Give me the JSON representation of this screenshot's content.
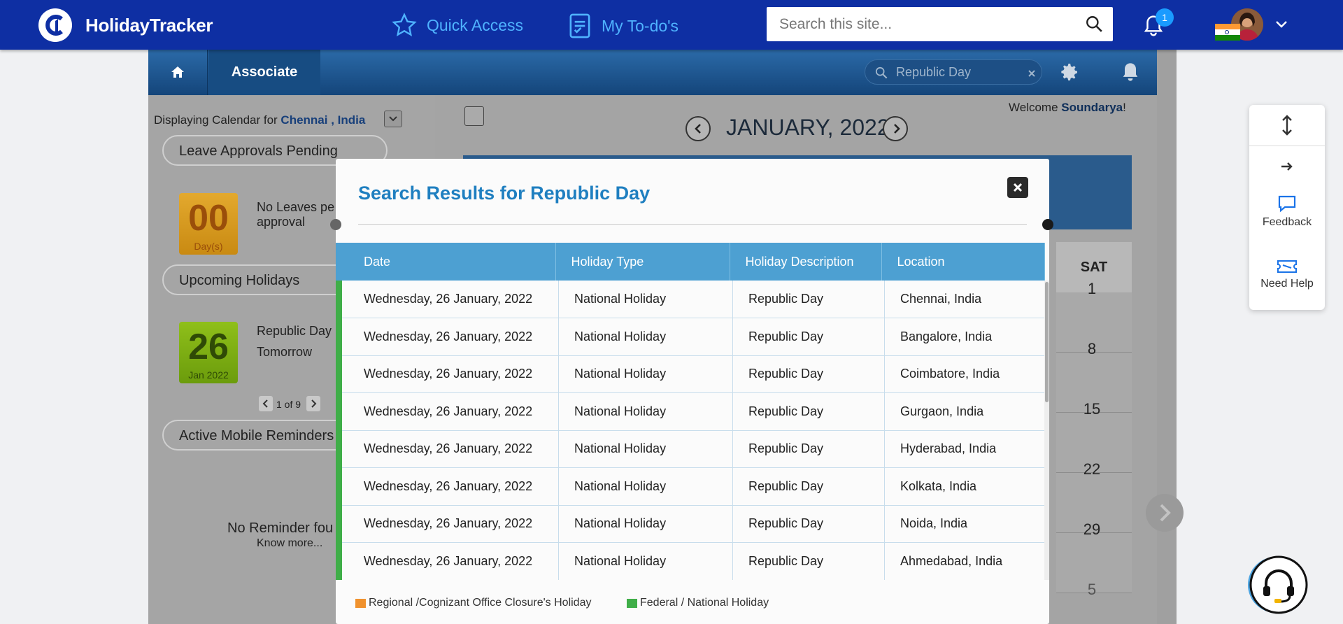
{
  "topbar": {
    "brand": "HolidayTracker",
    "quick_access": "Quick Access",
    "todos": "My To-do's",
    "search_placeholder": "Search this site...",
    "notification_count": "1",
    "accent": "#0e2fa3"
  },
  "subbar": {
    "tab": "Associate",
    "search_value": "Republic Day"
  },
  "left_panel": {
    "display_prefix": "Displaying Calendar for ",
    "location": "Chennai , India",
    "leave_title": "Leave Approvals Pending",
    "leave_count": "00",
    "leave_unit": "Day(s)",
    "leave_text_1": "No Leaves pe",
    "leave_text_2": "approval",
    "upcoming_title": "Upcoming Holidays",
    "upcoming_day": "26",
    "upcoming_month": "Jan 2022",
    "upcoming_name": "Republic Day",
    "upcoming_when": "Tomorrow",
    "pager": "1 of 9",
    "reminders_title": "Active Mobile Reminders",
    "no_reminder": "No Reminder fou",
    "know_more": "Know more..."
  },
  "calendar": {
    "welcome_prefix": "Welcome ",
    "user": "Soundarya",
    "welcome_suffix": "!",
    "month": "JANUARY, 2022",
    "sat_label": "SAT",
    "sat_dates": [
      "1",
      "8",
      "15",
      "22",
      "29",
      "5"
    ]
  },
  "side_panel": {
    "feedback": "Feedback",
    "need_help": "Need Help"
  },
  "modal": {
    "title": "Search Results for Republic Day",
    "columns": [
      "Date",
      "Holiday Type",
      "Holiday Description",
      "Location"
    ],
    "rows": [
      {
        "date": "Wednesday, 26 January, 2022",
        "type": "National Holiday",
        "desc": "Republic Day",
        "location": "Chennai, India"
      },
      {
        "date": "Wednesday, 26 January, 2022",
        "type": "National Holiday",
        "desc": "Republic Day",
        "location": "Bangalore, India"
      },
      {
        "date": "Wednesday, 26 January, 2022",
        "type": "National Holiday",
        "desc": "Republic Day",
        "location": "Coimbatore, India"
      },
      {
        "date": "Wednesday, 26 January, 2022",
        "type": "National Holiday",
        "desc": "Republic Day",
        "location": "Gurgaon, India"
      },
      {
        "date": "Wednesday, 26 January, 2022",
        "type": "National Holiday",
        "desc": "Republic Day",
        "location": "Hyderabad, India"
      },
      {
        "date": "Wednesday, 26 January, 2022",
        "type": "National Holiday",
        "desc": "Republic Day",
        "location": "Kolkata, India"
      },
      {
        "date": "Wednesday, 26 January, 2022",
        "type": "National Holiday",
        "desc": "Republic Day",
        "location": "Noida, India"
      },
      {
        "date": "Wednesday, 26 January, 2022",
        "type": "National Holiday",
        "desc": "Republic Day",
        "location": "Ahmedabad, India"
      }
    ],
    "legend_regional": "Regional /Cognizant Office Closure's Holiday",
    "legend_national": "Federal / National Holiday",
    "color_regional": "#f0922e",
    "color_national": "#3fae48"
  }
}
